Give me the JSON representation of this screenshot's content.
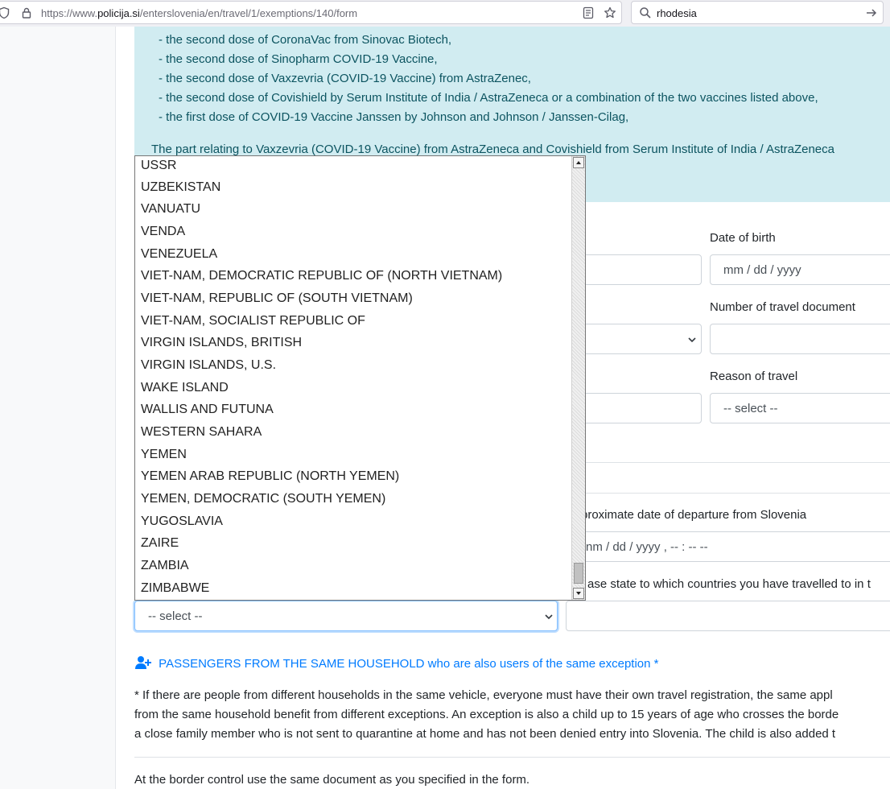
{
  "browser": {
    "url_prefix": "https://www.",
    "url_domain": "policija.si",
    "url_path": "/enterslovenia/en/travel/1/exemptions/140/form",
    "search_value": "rhodesia"
  },
  "info": {
    "items": [
      "- the second dose of CoronaVac from Sinovac Biotech,",
      "- the second dose of Sinopharm COVID-19 Vaccine,",
      "- the second dose of Vaxzevria (COVID-19 Vaccine) from AstraZenec,",
      "- the second dose of Covishield by Serum Institute of India / AstraZeneca or a combination of the two vaccines listed above,",
      "- the first dose of COVID-19 Vaccine Janssen by Johnson and Johnson / Janssen-Cilag,"
    ],
    "paragraph": "The part relating to Vaxzevria (COVID-19 Vaccine) from AstraZeneca and Covishield from Serum Institute of India / AstraZeneca"
  },
  "form": {
    "dob_label": "Date of birth",
    "dob_placeholder": "mm / dd / yyyy",
    "travel_doc_label": "Number of travel document",
    "reason_label": "Reason of travel",
    "reason_placeholder": "-- select --",
    "departure_label_partial": "proximate date of departure from Slovenia",
    "departure_placeholder": "nm / dd / yyyy ,  -- : --   --",
    "countries_label_partial": "ase state to which countries you have travelled to in t",
    "country_select_value": "-- select --"
  },
  "dropdown": {
    "options": [
      "USSR",
      "UZBEKISTAN",
      "VANUATU",
      "VENDA",
      "VENEZUELA",
      "VIET-NAM, DEMOCRATIC REPUBLIC OF (NORTH VIETNAM)",
      "VIET-NAM, REPUBLIC OF (SOUTH VIETNAM)",
      "VIET-NAM, SOCIALIST REPUBLIC OF",
      "VIRGIN ISLANDS, BRITISH",
      "VIRGIN ISLANDS, U.S.",
      "WAKE ISLAND",
      "WALLIS AND FUTUNA",
      "WESTERN SAHARA",
      "YEMEN",
      "YEMEN ARAB REPUBLIC (NORTH YEMEN)",
      "YEMEN, DEMOCRATIC (SOUTH YEMEN)",
      "YUGOSLAVIA",
      "ZAIRE",
      "ZAMBIA",
      "ZIMBABWE"
    ]
  },
  "passengers": {
    "label": "PASSENGERS FROM THE SAME HOUSEHOLD who are also users of the same exception *",
    "icon": "add-user-icon"
  },
  "notes": {
    "line1": "* If there are people from different households in the same vehicle, everyone must have their own travel registration, the same appl",
    "line2": "from the same household benefit from different exceptions. An exception is also a child up to 15 years of age who crosses the borde",
    "line3": "a close family member who is not sent to quarantine at home and has not been denied entry into Slovenia. The child is also added t",
    "border": "At the border control use the same document as you specified in the form."
  },
  "colors": {
    "info_bg": "#d1ecf1",
    "info_text": "#0c5460",
    "link_blue": "#007bff"
  }
}
